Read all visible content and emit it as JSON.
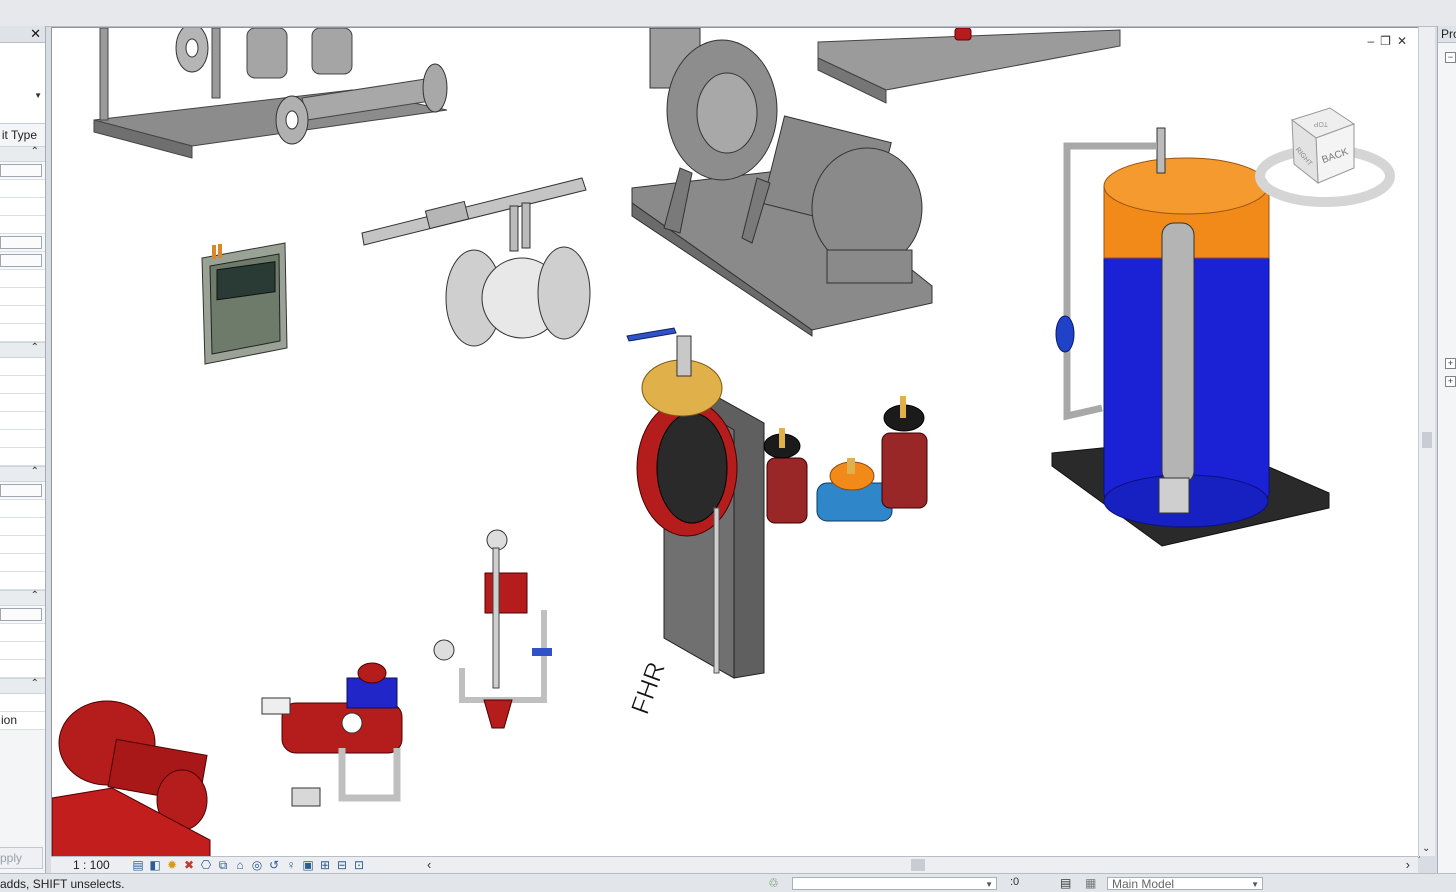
{
  "properties": {
    "close_icon": "close-icon",
    "type_label": "it Type",
    "row_text_1": "ion",
    "apply_label": "pply"
  },
  "viewport": {
    "window_controls": [
      "–",
      "❐",
      "✕"
    ],
    "model_label": "FHR",
    "viewcube": {
      "face": "BACK",
      "side": "RIGHT",
      "top": "TOP"
    }
  },
  "view_bar": {
    "scale": "1 : 100",
    "icons": [
      "detail-level-icon",
      "visual-style-icon",
      "sun-path-icon",
      "shadows-icon",
      "crop-view-icon",
      "show-crop-icon",
      "unlock-3d-icon",
      "temporary-hide-icon",
      "reveal-hidden-icon",
      "worksharing-icon",
      "design-options-icon",
      "analytical-model-icon"
    ]
  },
  "project_browser": {
    "title": "Pro"
  },
  "status_bar": {
    "text": "adds, SHIFT unselects.",
    "selection_count": ":0",
    "model_label": "Main Model"
  },
  "colors": {
    "pump_gray": "#8f8f8f",
    "fire_red": "#b51c1c",
    "tank_blue": "#1b22d6",
    "tank_orange": "#f28a1a",
    "valve_blue": "#2f86c9",
    "brass": "#e0b04a"
  }
}
